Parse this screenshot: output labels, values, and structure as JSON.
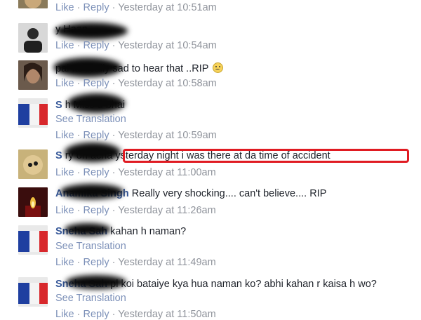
{
  "actions": {
    "like": "Like",
    "reply": "Reply",
    "separator": "·",
    "see_translation": "See Translation"
  },
  "accent_color": "#365899",
  "highlight_color": "#e01b22",
  "comments": [
    {
      "name": "",
      "text": "",
      "time": "Yesterday at 10:51am",
      "avatar": "partial-photo",
      "translation": false
    },
    {
      "name": "",
      "text": "y Haan..",
      "time": "Yesterday at 10:54am",
      "avatar": "person-photo",
      "translation": false
    },
    {
      "name": "",
      "text": "pai Its really sad to hear that ..RIP",
      "time": "Yesterday at 10:58am",
      "avatar": "portrait-photo",
      "translation": false,
      "emoji": "sad-face-emoji"
    },
    {
      "name": "S",
      "text": "h Miss u bhai",
      "time": "Yesterday at 10:59am",
      "avatar": "flag-photo",
      "translation": true
    },
    {
      "name": "S",
      "text": "ry oh acha ysterday night i was there at da time of accident",
      "time": "Yesterday at 11:00am",
      "avatar": "face-photo",
      "translation": false,
      "highlighted": true
    },
    {
      "name": "Anamika Singh",
      "text": "Really very shocking.... can't believe.... RIP",
      "time": "Yesterday at 11:26am",
      "avatar": "candle-photo",
      "translation": false
    },
    {
      "name": "Sneha Sah",
      "text": "kahan h naman?",
      "time": "Yesterday at 11:49am",
      "avatar": "flag-photo",
      "translation": true
    },
    {
      "name": "Sneha Sah",
      "text": "pl koi bataiye kya hua naman ko? abhi kahan r kaisa h wo?",
      "time": "Yesterday at 11:50am",
      "avatar": "flag-photo",
      "translation": true
    }
  ]
}
